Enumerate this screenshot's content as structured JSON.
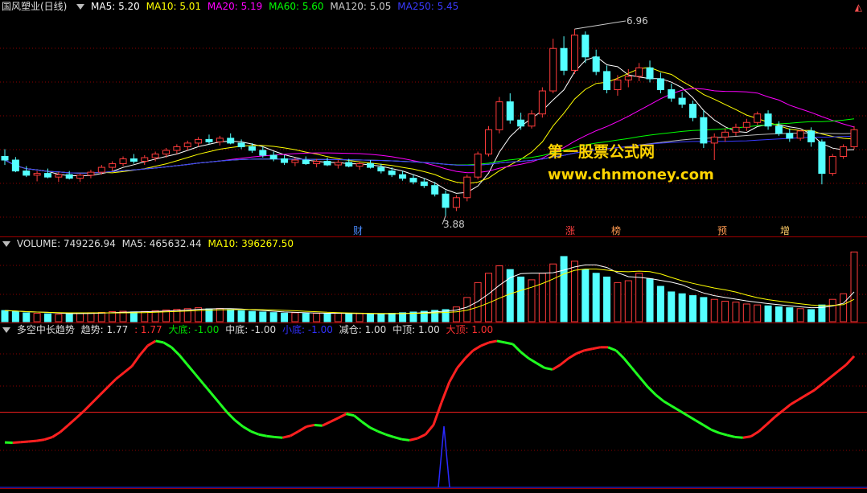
{
  "main": {
    "title": "国风塑业(日线)",
    "ma": [
      {
        "label": "MA5: 5.20",
        "color": "#ffffff"
      },
      {
        "label": "MA10: 5.01",
        "color": "#ffff00"
      },
      {
        "label": "MA20: 5.19",
        "color": "#ff00ff"
      },
      {
        "label": "MA60: 5.60",
        "color": "#00ff00"
      },
      {
        "label": "MA120: 5.05",
        "color": "#cccccc"
      },
      {
        "label": "MA250: 5.45",
        "color": "#3333ff"
      }
    ],
    "high_label": "6.96",
    "low_label": "3.88",
    "events": [
      "财",
      "涨",
      "榜",
      "预",
      "增"
    ]
  },
  "watermark": {
    "line1": "第一股票公式网",
    "line2": "www.chnmoney.com"
  },
  "volume": {
    "title": "VOLUME: 749226.94",
    "ma5": "MA5: 465632.44",
    "ma10": "MA10: 396267.50"
  },
  "indicator": {
    "title": "多空中长趋势",
    "items": [
      {
        "label": "趋势: 1.77",
        "color": "#dddddd"
      },
      {
        "label": ": 1.77",
        "color": "#ff3030"
      },
      {
        "label": "大底: -1.00",
        "color": "#00dd00"
      },
      {
        "label": "中底: -1.00",
        "color": "#dddddd"
      },
      {
        "label": "小底: -1.00",
        "color": "#3030ff"
      },
      {
        "label": "减仓: 1.00",
        "color": "#dddddd"
      },
      {
        "label": "中顶: 1.00",
        "color": "#dddddd"
      },
      {
        "label": "大顶: 1.00",
        "color": "#ff3030"
      }
    ]
  },
  "colors": {
    "up": "#ff3b3b",
    "down": "#54ffff",
    "grid": "#8b0000",
    "divider": "#a00000"
  },
  "chart_data": [
    {
      "type": "candlestick",
      "series": [
        {
          "name": "国风塑业(日线)",
          "values": [
            [
              4.86,
              4.98,
              4.72,
              4.8
            ],
            [
              4.8,
              4.85,
              4.6,
              4.62
            ],
            [
              4.62,
              4.7,
              4.52,
              4.55
            ],
            [
              4.55,
              4.62,
              4.45,
              4.58
            ],
            [
              4.58,
              4.66,
              4.5,
              4.52
            ],
            [
              4.52,
              4.6,
              4.44,
              4.56
            ],
            [
              4.56,
              4.62,
              4.48,
              4.5
            ],
            [
              4.5,
              4.58,
              4.44,
              4.55
            ],
            [
              4.55,
              4.64,
              4.5,
              4.6
            ],
            [
              4.6,
              4.72,
              4.56,
              4.68
            ],
            [
              4.68,
              4.78,
              4.62,
              4.74
            ],
            [
              4.74,
              4.86,
              4.7,
              4.82
            ],
            [
              4.82,
              4.9,
              4.74,
              4.78
            ],
            [
              4.78,
              4.88,
              4.72,
              4.84
            ],
            [
              4.84,
              4.94,
              4.78,
              4.9
            ],
            [
              4.9,
              5.0,
              4.84,
              4.96
            ],
            [
              4.96,
              5.06,
              4.9,
              5.02
            ],
            [
              5.02,
              5.12,
              4.96,
              5.08
            ],
            [
              5.08,
              5.18,
              5.02,
              5.14
            ],
            [
              5.14,
              5.22,
              5.06,
              5.1
            ],
            [
              5.1,
              5.2,
              5.04,
              5.16
            ],
            [
              5.16,
              5.24,
              5.06,
              5.08
            ],
            [
              5.08,
              5.14,
              4.98,
              5.02
            ],
            [
              5.02,
              5.08,
              4.92,
              4.96
            ],
            [
              4.96,
              5.02,
              4.84,
              4.88
            ],
            [
              4.88,
              4.94,
              4.78,
              4.82
            ],
            [
              4.82,
              4.88,
              4.72,
              4.76
            ],
            [
              4.76,
              4.84,
              4.7,
              4.8
            ],
            [
              4.8,
              4.86,
              4.72,
              4.74
            ],
            [
              4.74,
              4.82,
              4.68,
              4.78
            ],
            [
              4.78,
              4.84,
              4.7,
              4.72
            ],
            [
              4.72,
              4.8,
              4.66,
              4.76
            ],
            [
              4.76,
              4.82,
              4.68,
              4.7
            ],
            [
              4.7,
              4.78,
              4.64,
              4.74
            ],
            [
              4.74,
              4.8,
              4.66,
              4.68
            ],
            [
              4.68,
              4.74,
              4.58,
              4.62
            ],
            [
              4.62,
              4.68,
              4.52,
              4.56
            ],
            [
              4.56,
              4.62,
              4.46,
              4.5
            ],
            [
              4.5,
              4.56,
              4.4,
              4.44
            ],
            [
              4.44,
              4.5,
              4.34,
              4.38
            ],
            [
              4.38,
              4.44,
              4.2,
              4.24
            ],
            [
              4.24,
              4.3,
              3.88,
              4.02
            ],
            [
              4.02,
              4.22,
              3.96,
              4.18
            ],
            [
              4.18,
              4.56,
              4.12,
              4.52
            ],
            [
              4.52,
              4.94,
              4.48,
              4.9
            ],
            [
              4.9,
              5.36,
              4.86,
              5.3
            ],
            [
              5.3,
              5.84,
              5.24,
              5.76
            ],
            [
              5.76,
              5.9,
              5.4,
              5.46
            ],
            [
              5.46,
              5.58,
              5.3,
              5.36
            ],
            [
              5.36,
              5.62,
              5.32,
              5.56
            ],
            [
              5.56,
              6.0,
              5.5,
              5.94
            ],
            [
              5.94,
              6.8,
              5.9,
              6.64
            ],
            [
              6.64,
              6.84,
              6.2,
              6.28
            ],
            [
              6.28,
              6.96,
              6.22,
              6.86
            ],
            [
              6.86,
              6.92,
              6.4,
              6.5
            ],
            [
              6.5,
              6.62,
              6.2,
              6.26
            ],
            [
              6.26,
              6.36,
              5.9,
              5.96
            ],
            [
              5.96,
              6.2,
              5.86,
              6.12
            ],
            [
              6.12,
              6.3,
              6.0,
              6.18
            ],
            [
              6.18,
              6.4,
              6.1,
              6.32
            ],
            [
              6.32,
              6.44,
              6.08,
              6.14
            ],
            [
              6.14,
              6.24,
              5.9,
              5.96
            ],
            [
              5.96,
              6.06,
              5.76,
              5.82
            ],
            [
              5.82,
              5.92,
              5.66,
              5.72
            ],
            [
              5.72,
              5.78,
              5.44,
              5.5
            ],
            [
              5.5,
              5.62,
              5.0,
              5.08
            ],
            [
              5.08,
              5.24,
              4.8,
              5.18
            ],
            [
              5.18,
              5.32,
              5.1,
              5.26
            ],
            [
              5.26,
              5.4,
              5.2,
              5.34
            ],
            [
              5.34,
              5.48,
              5.28,
              5.42
            ],
            [
              5.42,
              5.6,
              5.38,
              5.56
            ],
            [
              5.56,
              5.62,
              5.3,
              5.36
            ],
            [
              5.36,
              5.44,
              5.2,
              5.24
            ],
            [
              5.24,
              5.32,
              5.1,
              5.16
            ],
            [
              5.16,
              5.3,
              5.12,
              5.28
            ],
            [
              5.28,
              5.34,
              5.02,
              5.1
            ],
            [
              5.1,
              5.14,
              4.4,
              4.58
            ],
            [
              4.58,
              4.9,
              4.54,
              4.86
            ],
            [
              4.86,
              5.06,
              4.82,
              5.02
            ],
            [
              5.02,
              5.36,
              4.98,
              5.3
            ]
          ]
        }
      ],
      "labels": [
        "6.96",
        "3.88"
      ]
    },
    {
      "type": "bar",
      "series": [
        {
          "name": "VOLUME",
          "values": [
            120,
            110,
            95,
            90,
            85,
            80,
            88,
            92,
            96,
            100,
            108,
            112,
            105,
            110,
            118,
            126,
            132,
            140,
            150,
            138,
            142,
            130,
            118,
            110,
            104,
            98,
            92,
            96,
            88,
            90,
            86,
            92,
            84,
            88,
            80,
            84,
            90,
            96,
            104,
            112,
            122,
            130,
            158,
            260,
            420,
            520,
            600,
            560,
            480,
            450,
            520,
            620,
            700,
            650,
            560,
            520,
            480,
            420,
            440,
            520,
            460,
            380,
            320,
            300,
            280,
            260,
            240,
            220,
            210,
            190,
            180,
            170,
            160,
            150,
            140,
            130,
            180,
            240,
            300,
            749
          ]
        }
      ]
    },
    {
      "type": "line",
      "series": [
        {
          "name": "多空中长趋势",
          "values": [
            -0.95,
            -0.96,
            -0.94,
            -0.92,
            -0.9,
            -0.86,
            -0.78,
            -0.62,
            -0.4,
            -0.18,
            0.05,
            0.3,
            0.55,
            0.8,
            1.05,
            1.25,
            1.45,
            1.8,
            2.1,
            2.25,
            2.2,
            2.05,
            1.8,
            1.5,
            1.2,
            0.9,
            0.6,
            0.3,
            0.0,
            -0.25,
            -0.45,
            -0.6,
            -0.7,
            -0.75,
            -0.78,
            -0.8,
            -0.74,
            -0.6,
            -0.45,
            -0.4,
            -0.42,
            -0.3,
            -0.18,
            -0.05,
            -0.1,
            -0.3,
            -0.48,
            -0.6,
            -0.7,
            -0.78,
            -0.85,
            -0.88,
            -0.82,
            -0.7,
            -0.4,
            0.3,
            0.95,
            1.4,
            1.7,
            1.95,
            2.1,
            2.2,
            2.25,
            2.2,
            2.15,
            1.9,
            1.7,
            1.55,
            1.4,
            1.35,
            1.5,
            1.7,
            1.85,
            1.95,
            2.0,
            2.05,
            2.05,
            1.95,
            1.7,
            1.4,
            1.1,
            0.8,
            0.55,
            0.35,
            0.2,
            0.05,
            -0.1,
            -0.25,
            -0.4,
            -0.55,
            -0.65,
            -0.72,
            -0.78,
            -0.8,
            -0.76,
            -0.6,
            -0.38,
            -0.15,
            0.05,
            0.25,
            0.4,
            0.55,
            0.7,
            0.9,
            1.1,
            1.3,
            1.5,
            1.77
          ]
        }
      ],
      "reference_lines": [
        0
      ]
    }
  ]
}
